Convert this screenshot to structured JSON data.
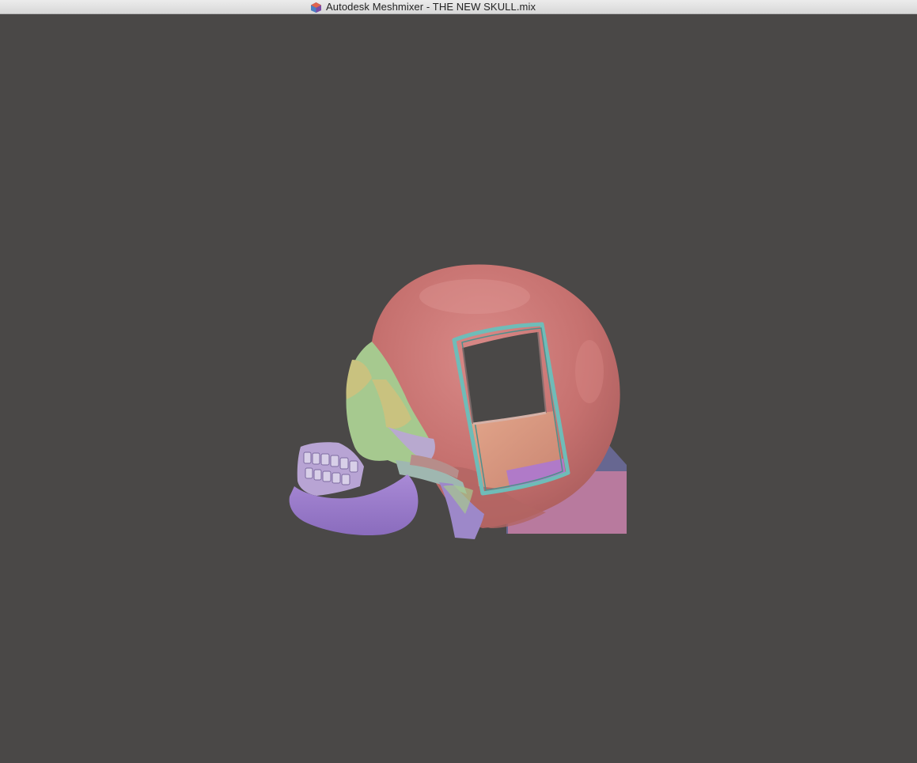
{
  "window": {
    "title": "Autodesk Meshmixer - THE NEW SKULL.mix",
    "app_icon": "meshmixer-app-icon"
  },
  "viewport": {
    "background": "#4a4847",
    "model": "skull-mesh"
  },
  "colors": {
    "cranium": "#c97776",
    "jaw": "#9a7ec8",
    "face_green": "#a6c98f",
    "face_yellow": "#c9c27f",
    "box_pink": "#b87a9e",
    "box_blue": "#676791",
    "frame_teal": "#6fbcb8"
  }
}
